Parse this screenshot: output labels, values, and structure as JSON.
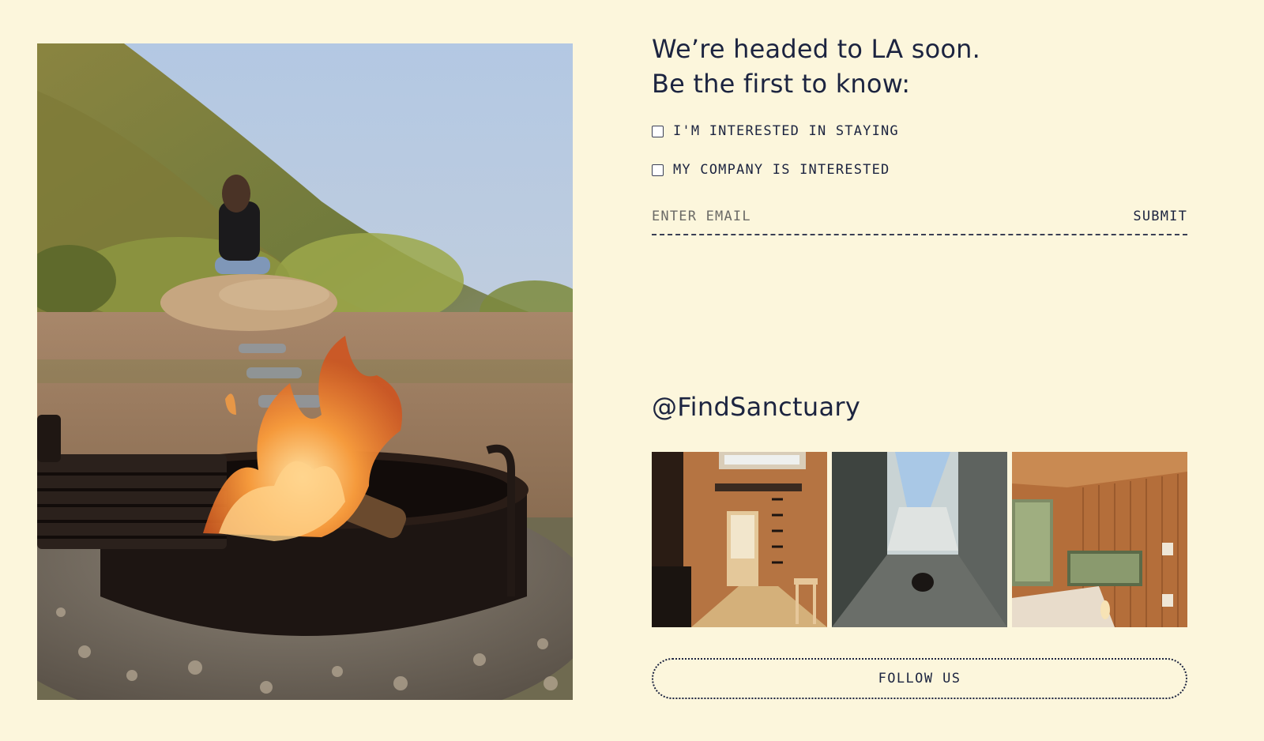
{
  "signup": {
    "headline_line1": "We’re headed to LA soon.",
    "headline_line2": "Be the first to know:",
    "options": [
      {
        "label": "I'M INTERESTED IN STAYING",
        "checked": false
      },
      {
        "label": "MY COMPANY IS INTERESTED",
        "checked": false
      }
    ],
    "email_placeholder": "ENTER EMAIL",
    "email_value": "",
    "submit_label": "SUBMIT"
  },
  "social": {
    "handle": "@FindSanctuary",
    "gallery": [
      {
        "subject": "cabin-interior-photo"
      },
      {
        "subject": "skylight-photo"
      },
      {
        "subject": "wood-bedroom-photo"
      }
    ],
    "follow_label": "FOLLOW US"
  },
  "hero": {
    "subject": "campfire-hillside-photo"
  },
  "colors": {
    "background": "#fcf6dc",
    "text": "#1c2440"
  }
}
